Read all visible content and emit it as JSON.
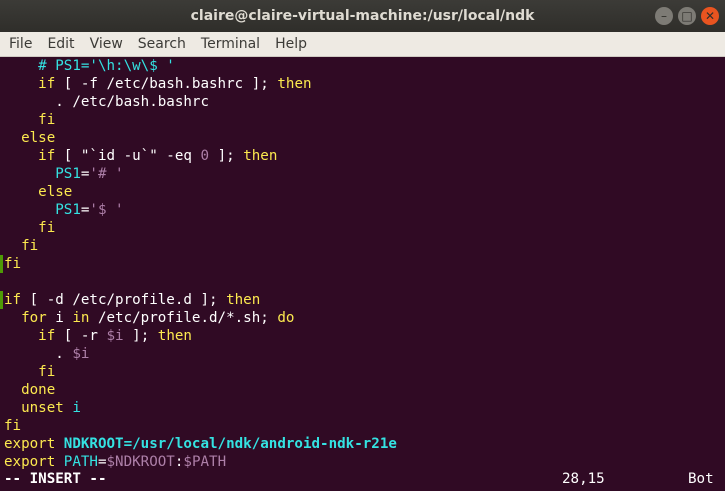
{
  "window": {
    "title": "claire@claire-virtual-machine:/usr/local/ndk",
    "buttons": {
      "minimize": "–",
      "maximize": "□",
      "close": "✕"
    }
  },
  "menu": {
    "items": [
      "File",
      "Edit",
      "View",
      "Search",
      "Terminal",
      "Help"
    ]
  },
  "editor": {
    "lines": [
      {
        "indent": "    ",
        "segments": [
          {
            "t": "# PS1='\\h:\\w\\$ '",
            "c": "cm"
          }
        ]
      },
      {
        "indent": "    ",
        "segments": [
          {
            "t": "if",
            "c": "kw"
          },
          {
            "t": " [ -f /etc/bash.bashrc ]; ",
            "c": ""
          },
          {
            "t": "then",
            "c": "kw"
          }
        ]
      },
      {
        "indent": "      ",
        "segments": [
          {
            "t": ". /etc/bash.bashrc",
            "c": ""
          }
        ]
      },
      {
        "indent": "    ",
        "segments": [
          {
            "t": "fi",
            "c": "kw"
          }
        ]
      },
      {
        "indent": "  ",
        "segments": [
          {
            "t": "else",
            "c": "kw"
          }
        ]
      },
      {
        "indent": "    ",
        "segments": [
          {
            "t": "if",
            "c": "kw"
          },
          {
            "t": " [ \"`id -u`\" -eq ",
            "c": ""
          },
          {
            "t": "0",
            "c": "num"
          },
          {
            "t": " ]; ",
            "c": ""
          },
          {
            "t": "then",
            "c": "kw"
          }
        ]
      },
      {
        "indent": "      ",
        "segments": [
          {
            "t": "PS1",
            "c": "var"
          },
          {
            "t": "=",
            "c": ""
          },
          {
            "t": "'# '",
            "c": "str"
          }
        ]
      },
      {
        "indent": "    ",
        "segments": [
          {
            "t": "else",
            "c": "kw"
          }
        ]
      },
      {
        "indent": "      ",
        "segments": [
          {
            "t": "PS1",
            "c": "var"
          },
          {
            "t": "=",
            "c": ""
          },
          {
            "t": "'$ '",
            "c": "str"
          }
        ]
      },
      {
        "indent": "    ",
        "segments": [
          {
            "t": "fi",
            "c": "kw"
          }
        ]
      },
      {
        "indent": "  ",
        "segments": [
          {
            "t": "fi",
            "c": "kw"
          }
        ]
      },
      {
        "indent": "",
        "segments": [
          {
            "t": "fi",
            "c": "kw"
          }
        ],
        "mark": true
      },
      {
        "indent": "",
        "segments": []
      },
      {
        "indent": "",
        "segments": [
          {
            "t": "if",
            "c": "kw"
          },
          {
            "t": " [ -d /etc/profile.d ]; ",
            "c": ""
          },
          {
            "t": "then",
            "c": "kw"
          }
        ],
        "mark": true
      },
      {
        "indent": "  ",
        "segments": [
          {
            "t": "for",
            "c": "kw"
          },
          {
            "t": " i ",
            "c": ""
          },
          {
            "t": "in",
            "c": "kw"
          },
          {
            "t": " /etc/profile.d/*.sh; ",
            "c": ""
          },
          {
            "t": "do",
            "c": "kw"
          }
        ]
      },
      {
        "indent": "    ",
        "segments": [
          {
            "t": "if",
            "c": "kw"
          },
          {
            "t": " [ -r ",
            "c": ""
          },
          {
            "t": "$i",
            "c": "str"
          },
          {
            "t": " ]; ",
            "c": ""
          },
          {
            "t": "then",
            "c": "kw"
          }
        ]
      },
      {
        "indent": "      ",
        "segments": [
          {
            "t": ". ",
            "c": ""
          },
          {
            "t": "$i",
            "c": "str"
          }
        ]
      },
      {
        "indent": "    ",
        "segments": [
          {
            "t": "fi",
            "c": "kw"
          }
        ]
      },
      {
        "indent": "  ",
        "segments": [
          {
            "t": "done",
            "c": "kw"
          }
        ]
      },
      {
        "indent": "  ",
        "segments": [
          {
            "t": "unset",
            "c": "kw"
          },
          {
            "t": " ",
            "c": ""
          },
          {
            "t": "i",
            "c": "var"
          }
        ]
      },
      {
        "indent": "",
        "segments": [
          {
            "t": "fi",
            "c": "kw"
          }
        ]
      },
      {
        "indent": "",
        "segments": [
          {
            "t": "export",
            "c": "kw"
          },
          {
            "t": " ",
            "c": ""
          },
          {
            "t": "NDKROOT",
            "c": "exp-path"
          },
          {
            "t": "=/usr/local/ndk/android-ndk-r21e",
            "c": "exp-path"
          }
        ]
      },
      {
        "indent": "",
        "segments": [
          {
            "t": "export",
            "c": "kw"
          },
          {
            "t": " ",
            "c": ""
          },
          {
            "t": "PATH",
            "c": "var"
          },
          {
            "t": "=",
            "c": ""
          },
          {
            "t": "$NDKROOT",
            "c": "str"
          },
          {
            "t": ":",
            "c": ""
          },
          {
            "t": "$PATH",
            "c": "str"
          }
        ]
      }
    ]
  },
  "status": {
    "mode": "-- INSERT --",
    "position": "28,15",
    "scroll": "Bot"
  },
  "colors": {
    "background": "#300a24",
    "keyword": "#fce94f",
    "string": "#ad7fa8",
    "variable": "#34e2e2"
  }
}
